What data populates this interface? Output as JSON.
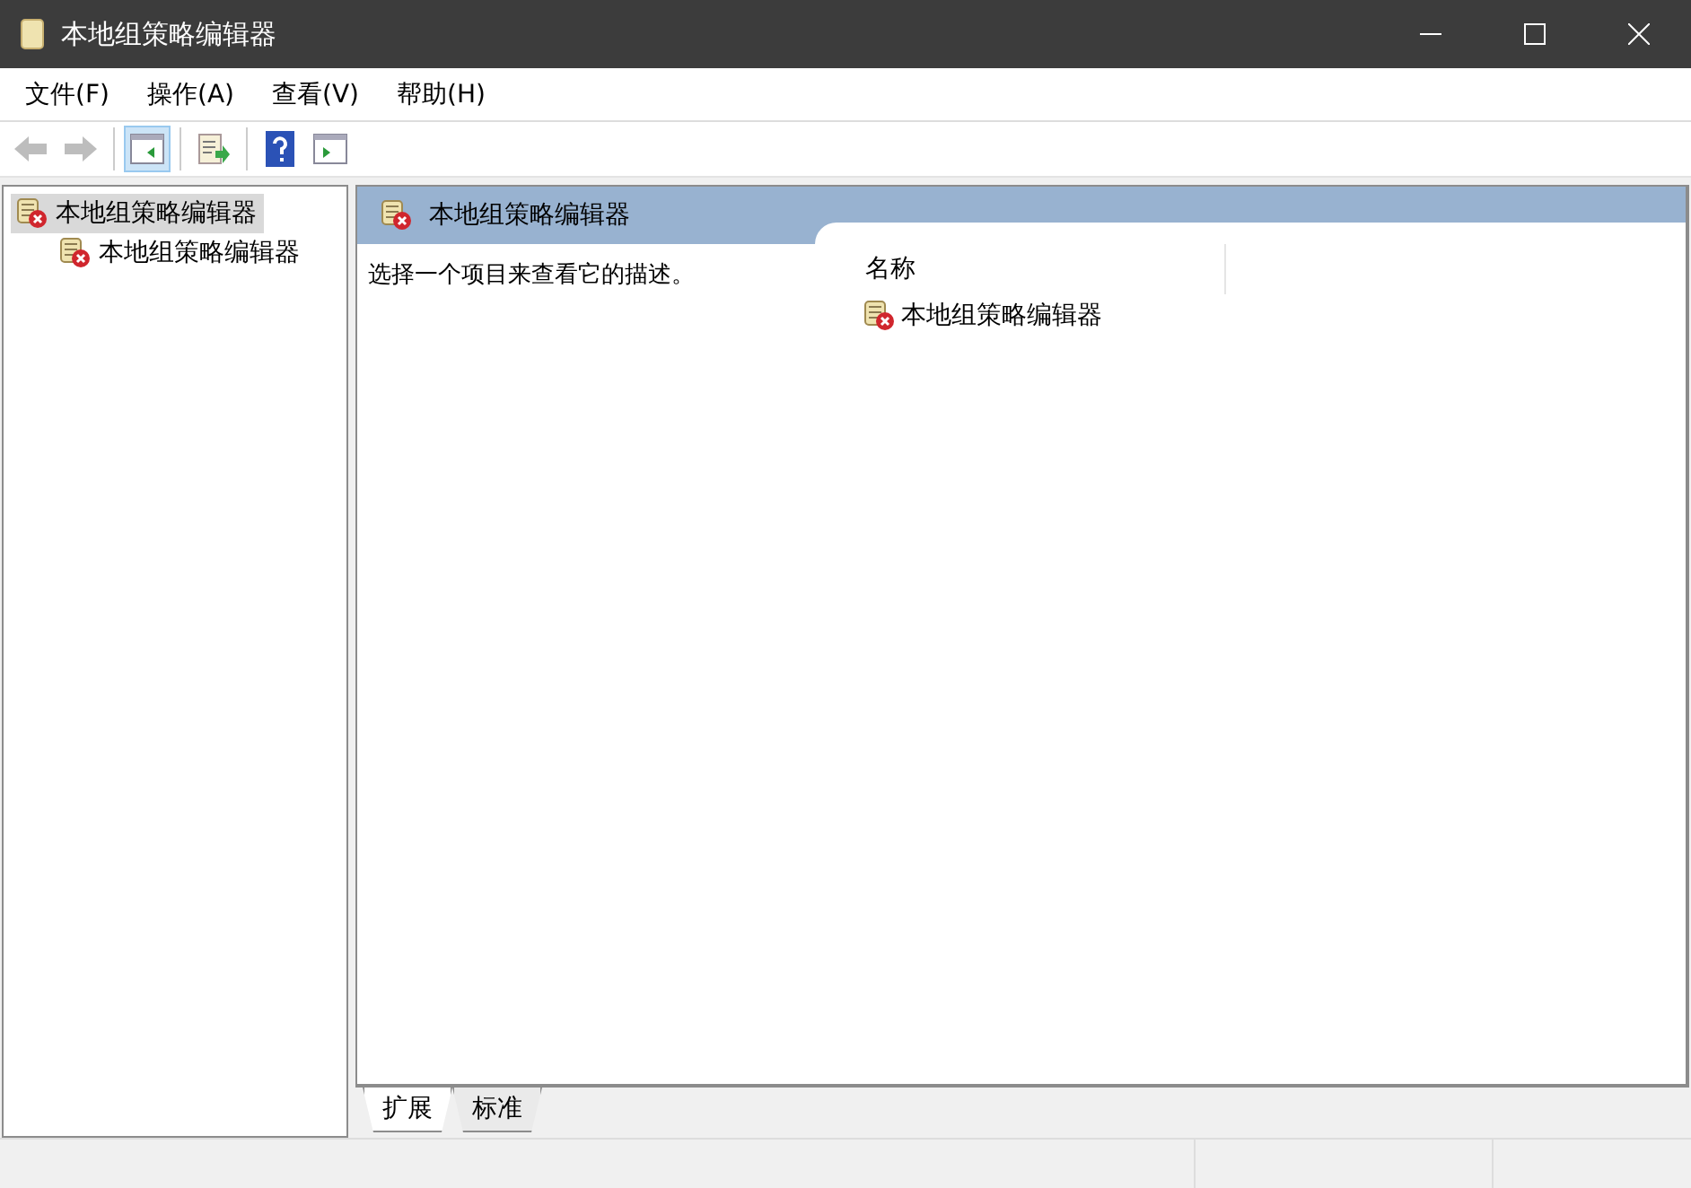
{
  "window": {
    "title": "本地组策略编辑器"
  },
  "menu": [
    "文件(F)",
    "操作(A)",
    "查看(V)",
    "帮助(H)"
  ],
  "toolbar": [
    {
      "kind": "back",
      "disabled": true,
      "on": false
    },
    {
      "kind": "forward",
      "disabled": true,
      "on": false
    },
    {
      "kind": "separator"
    },
    {
      "kind": "tree",
      "disabled": false,
      "on": true
    },
    {
      "kind": "separator"
    },
    {
      "kind": "export",
      "disabled": false,
      "on": false
    },
    {
      "kind": "separator"
    },
    {
      "kind": "help",
      "disabled": false,
      "on": false
    },
    {
      "kind": "action",
      "disabled": false,
      "on": false
    }
  ],
  "tree": [
    {
      "label": "本地组策略编辑器",
      "selected": true,
      "children": [
        {
          "label": "本地组策略编辑器",
          "selected": false
        }
      ]
    }
  ],
  "detail": {
    "title": "本地组策略编辑器",
    "description": "选择一个项目来查看它的描述。",
    "columns": [
      "名称"
    ],
    "rows": [
      "本地组策略编辑器"
    ]
  },
  "tabs": [
    {
      "label": "扩展",
      "selected": true
    },
    {
      "label": "标准",
      "selected": false
    }
  ]
}
